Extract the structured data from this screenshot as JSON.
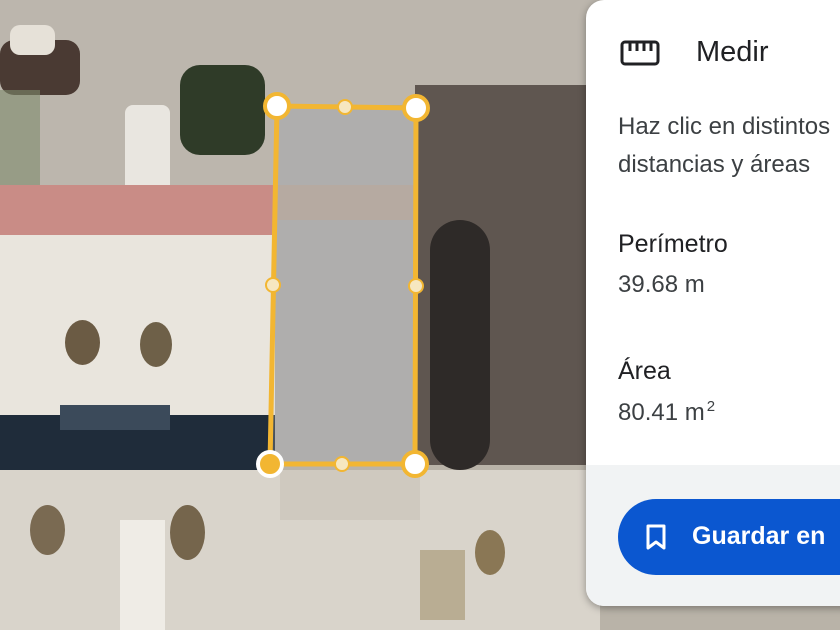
{
  "map": {
    "polygon_color": "#f2b632",
    "vertex_fill": "#ffffff",
    "active_vertex_fill": "#f2b632"
  },
  "panel": {
    "title": "Medir",
    "title_icon": "ruler-icon",
    "instructions_line1": "Haz clic en distintos",
    "instructions_line2": "distancias y áreas",
    "perimeter_label": "Perímetro",
    "perimeter_value": "39.68 m",
    "area_label": "Área",
    "area_value": "80.41 m",
    "area_unit_exponent": "2",
    "save_button_label": "Guardar en",
    "save_button_icon": "bookmark-icon",
    "accent_color": "#0b57d0"
  }
}
